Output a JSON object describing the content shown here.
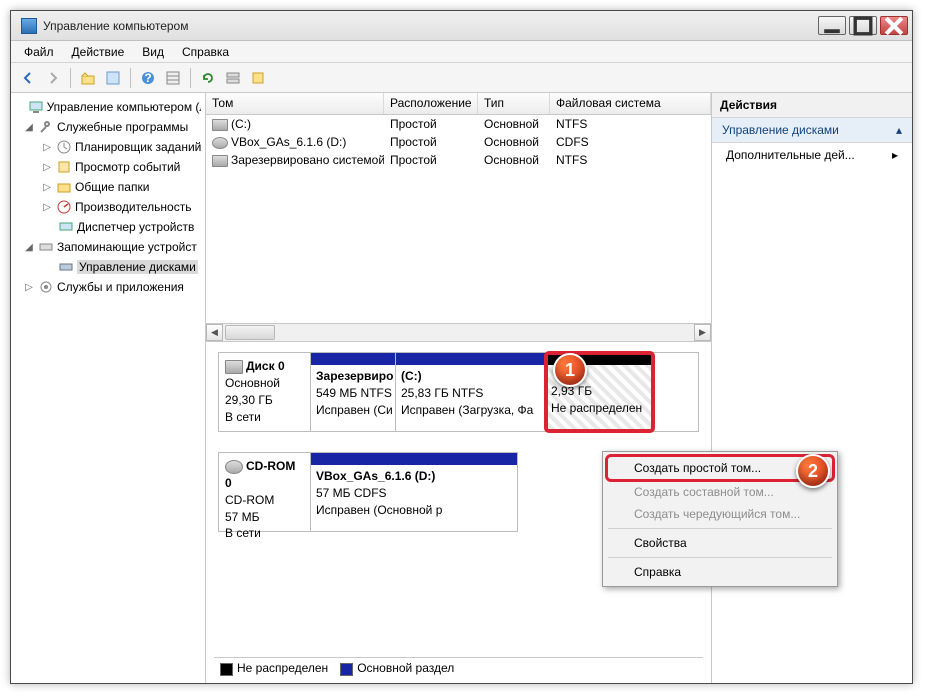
{
  "title": "Управление компьютером",
  "menu": {
    "file": "Файл",
    "action": "Действие",
    "view": "Вид",
    "help": "Справка"
  },
  "tree": {
    "root": "Управление компьютером (л",
    "sys": "Служебные программы",
    "sched": "Планировщик заданий",
    "evt": "Просмотр событий",
    "shared": "Общие папки",
    "perf": "Производительность",
    "dev": "Диспетчер устройств",
    "storage": "Запоминающие устройст",
    "diskmgmt": "Управление дисками",
    "services": "Службы и приложения"
  },
  "columns": {
    "vol": "Том",
    "layout": "Расположение",
    "type": "Тип",
    "fs": "Файловая система"
  },
  "volumes": [
    {
      "name": "(C:)",
      "layout": "Простой",
      "type": "Основной",
      "fs": "NTFS"
    },
    {
      "name": "VBox_GAs_6.1.6 (D:)",
      "layout": "Простой",
      "type": "Основной",
      "fs": "CDFS"
    },
    {
      "name": "Зарезервировано системой",
      "layout": "Простой",
      "type": "Основной",
      "fs": "NTFS"
    }
  ],
  "disk0": {
    "title": "Диск 0",
    "type": "Основной",
    "size": "29,30 ГБ",
    "status": "В сети",
    "p1": {
      "name": "Зарезервиро",
      "size": "549 МБ NTFS",
      "status": "Исправен (Си"
    },
    "p2": {
      "name": "(C:)",
      "size": "25,83 ГБ NTFS",
      "status": "Исправен (Загрузка, Фа"
    },
    "p3": {
      "size": "2,93 ГБ",
      "status": "Не распределен"
    }
  },
  "cdrom": {
    "title": "CD-ROM 0",
    "type": "CD-ROM",
    "size": "57 МБ",
    "status": "В сети",
    "v": {
      "name": "VBox_GAs_6.1.6 (D:)",
      "size": "57 МБ CDFS",
      "status": "Исправен (Основной р"
    }
  },
  "legend": {
    "unalloc": "Не распределен",
    "primary": "Основной раздел"
  },
  "actions": {
    "header": "Действия",
    "sel": "Управление дисками",
    "more": "Дополнительные дей..."
  },
  "ctx": {
    "simple": "Создать простой том...",
    "spanned": "Создать составной том...",
    "striped": "Создать чередующийся том...",
    "props": "Свойства",
    "help": "Справка"
  },
  "badge1": "1",
  "badge2": "2"
}
